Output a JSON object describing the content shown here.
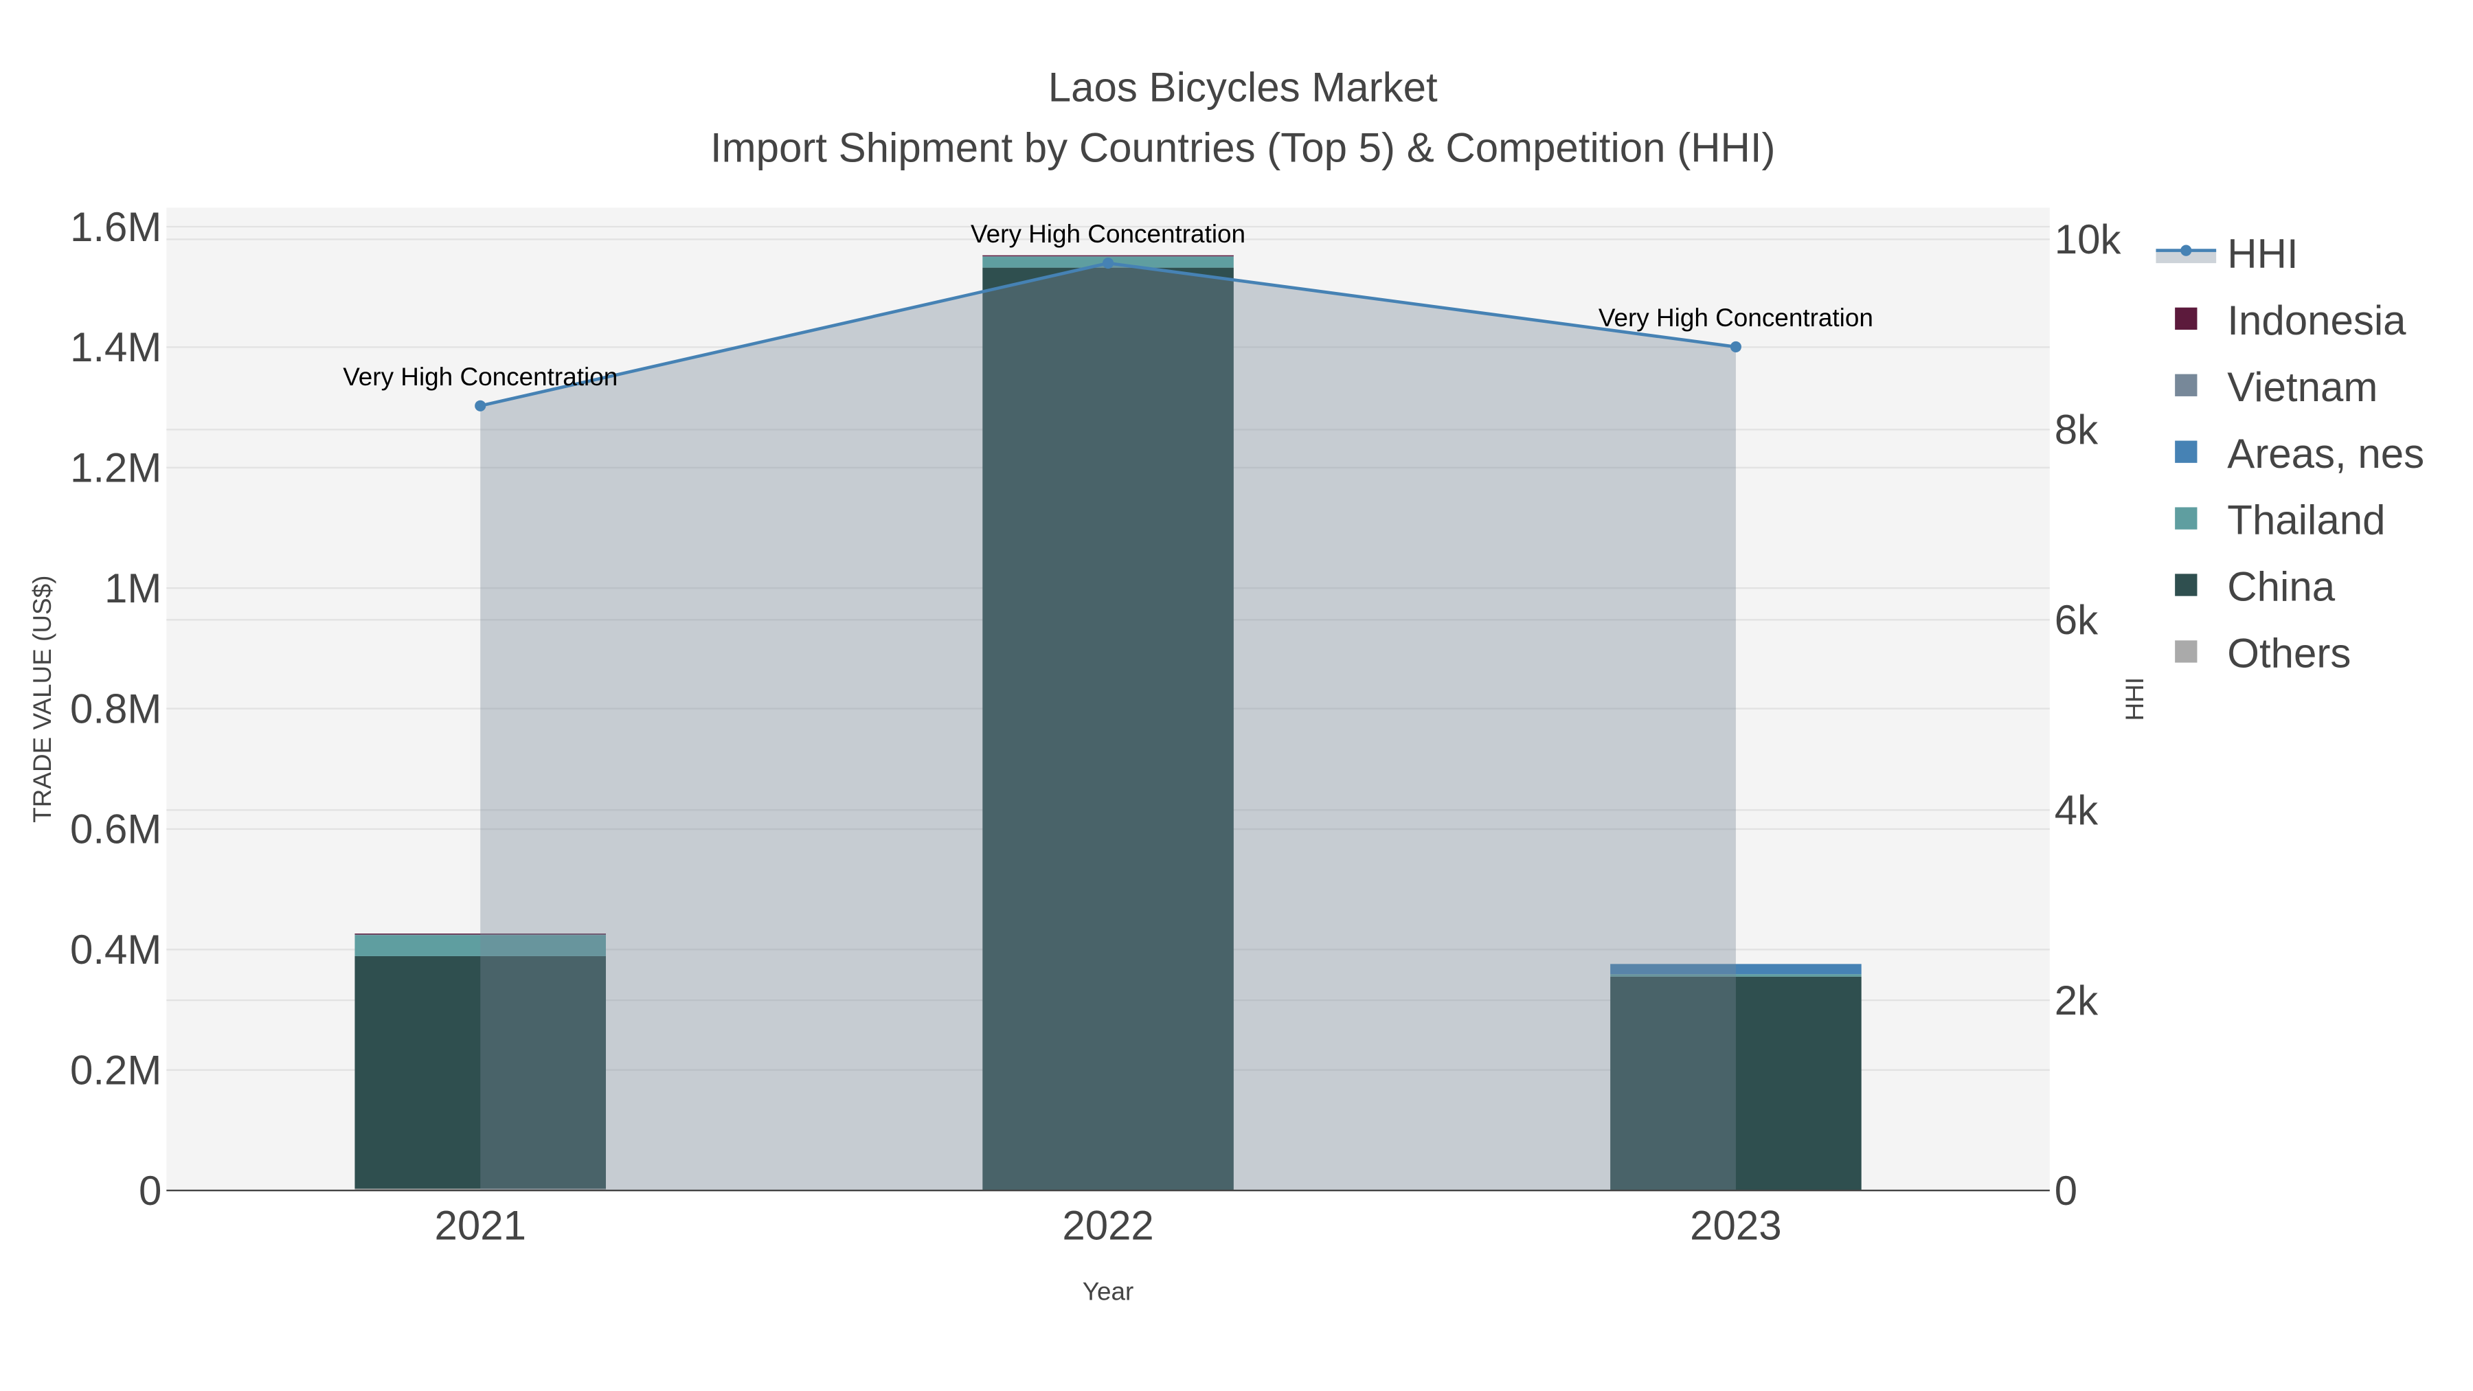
{
  "chart_data": {
    "type": "bar",
    "title": "Laos Bicycles Market",
    "subtitle": "Import Shipment by Countries (Top 5) & Competition (HHI)",
    "xlabel": "Year",
    "ylabel": "TRADE VALUE (US$)",
    "y2label": "HHI",
    "categories": [
      "2021",
      "2022",
      "2023"
    ],
    "ylim": [
      0,
      1630000
    ],
    "y2lim": [
      0,
      10200
    ],
    "yticks": [
      {
        "v": 0,
        "t": "0"
      },
      {
        "v": 200000,
        "t": "0.2M"
      },
      {
        "v": 400000,
        "t": "0.4M"
      },
      {
        "v": 600000,
        "t": "0.6M"
      },
      {
        "v": 800000,
        "t": "0.8M"
      },
      {
        "v": 1000000,
        "t": "1M"
      },
      {
        "v": 1200000,
        "t": "1.2M"
      },
      {
        "v": 1400000,
        "t": "1.4M"
      },
      {
        "v": 1600000,
        "t": "1.6M"
      }
    ],
    "y2ticks": [
      {
        "v": 0,
        "t": "0"
      },
      {
        "v": 2000,
        "t": "2k"
      },
      {
        "v": 4000,
        "t": "4k"
      },
      {
        "v": 6000,
        "t": "6k"
      },
      {
        "v": 8000,
        "t": "8k"
      },
      {
        "v": 10000,
        "t": "10k"
      }
    ],
    "grid": true,
    "legend_position": "right",
    "series": [
      {
        "name": "Others",
        "color": "#aaaaaa",
        "values": [
          3000,
          1000,
          1000
        ]
      },
      {
        "name": "China",
        "color": "#2f4f4f",
        "values": [
          386000,
          1531000,
          354000
        ]
      },
      {
        "name": "Thailand",
        "color": "#5f9ea0",
        "values": [
          35000,
          18000,
          4000
        ]
      },
      {
        "name": "Areas, nes",
        "color": "#4682b4",
        "values": [
          0,
          0,
          17000
        ]
      },
      {
        "name": "Vietnam",
        "color": "#778899",
        "values": [
          2000,
          2000,
          0
        ]
      },
      {
        "name": "Indonesia",
        "color": "#5c1a3c",
        "values": [
          500,
          500,
          0
        ]
      }
    ],
    "legend_order": [
      "HHI",
      "Indonesia",
      "Vietnam",
      "Areas, nes",
      "Thailand",
      "China",
      "Others"
    ],
    "hhi": {
      "name": "HHI",
      "color": "#4682b4",
      "values": [
        8250,
        9750,
        8870
      ],
      "annotations": [
        "Very High Concentration",
        "Very High Concentration",
        "Very High Concentration"
      ]
    }
  }
}
